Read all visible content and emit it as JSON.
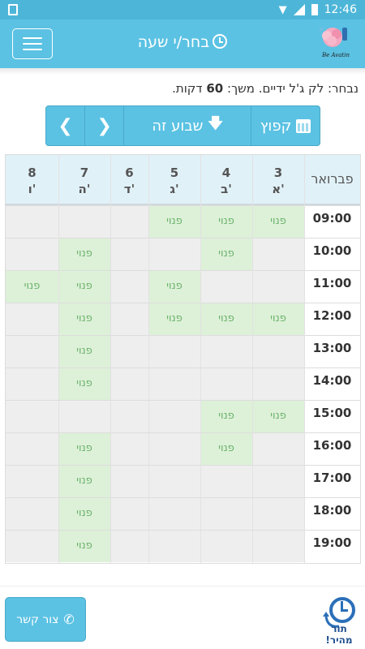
{
  "status_bar": {
    "time": "12:46"
  },
  "header": {
    "title": "בחר/י שעה",
    "logo_text": "Be Avatin"
  },
  "selection": {
    "prefix": "נבחר: לק ג'ל ידיים. משך: ",
    "duration": "60",
    "suffix": " דקות."
  },
  "nav": {
    "jump_label": "קפוץ",
    "this_week_label": "שבוע זה"
  },
  "calendar": {
    "month": "פברואר",
    "days": [
      {
        "num": "3",
        "name": "א'"
      },
      {
        "num": "4",
        "name": "ב'"
      },
      {
        "num": "5",
        "name": "ג'"
      },
      {
        "num": "6",
        "name": "ד'"
      },
      {
        "num": "7",
        "name": "ה'"
      },
      {
        "num": "8",
        "name": "ו'"
      }
    ],
    "times": [
      "09:00",
      "10:00",
      "11:00",
      "12:00",
      "13:00",
      "14:00",
      "15:00",
      "16:00",
      "17:00",
      "18:00",
      "19:00"
    ],
    "free_label": "פנוי",
    "slots": [
      [
        "free",
        "free",
        "free",
        "busy",
        "busy",
        "busy"
      ],
      [
        "busy",
        "free",
        "busy",
        "busy",
        "free",
        "busy"
      ],
      [
        "busy",
        "busy",
        "free",
        "busy",
        "free",
        "free"
      ],
      [
        "free",
        "free",
        "free",
        "busy",
        "free",
        "busy"
      ],
      [
        "busy",
        "busy",
        "busy",
        "busy",
        "free",
        "busy"
      ],
      [
        "busy",
        "busy",
        "busy",
        "busy",
        "free",
        "busy"
      ],
      [
        "free",
        "free",
        "busy",
        "busy",
        "busy",
        "busy"
      ],
      [
        "busy",
        "free",
        "busy",
        "busy",
        "free",
        "busy"
      ],
      [
        "busy",
        "busy",
        "busy",
        "busy",
        "free",
        "busy"
      ],
      [
        "busy",
        "busy",
        "busy",
        "busy",
        "free",
        "busy"
      ],
      [
        "busy",
        "busy",
        "busy",
        "busy",
        "free",
        "busy"
      ]
    ]
  },
  "footer": {
    "contact_label": "צור קשר",
    "quick_queue_label": "תור מהיר!"
  },
  "colors": {
    "accent": "#5bc2e3",
    "free_bg": "#ddf0d8",
    "busy_bg": "#eeeeee",
    "header_row_bg": "#e1f1f8"
  }
}
